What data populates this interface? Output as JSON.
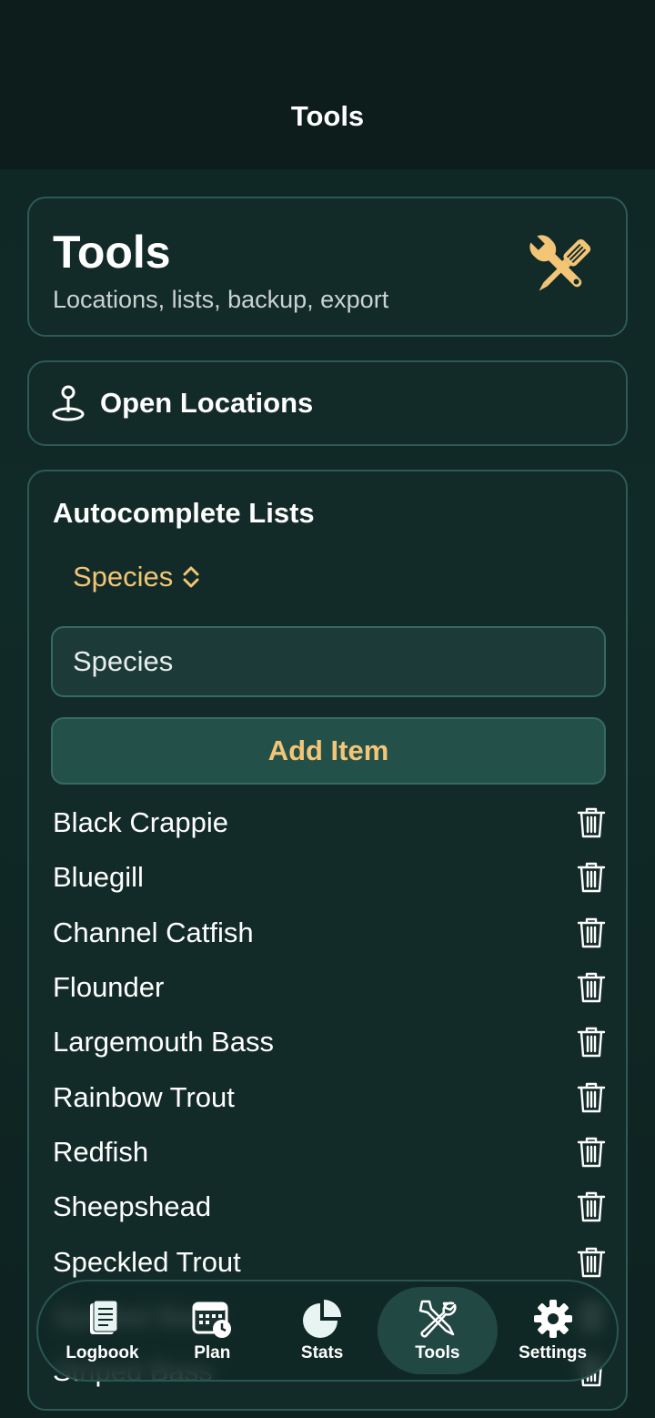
{
  "nav": {
    "title": "Tools"
  },
  "hero": {
    "title": "Tools",
    "subtitle": "Locations, lists, backup, export",
    "icon": "tools-icon"
  },
  "locations": {
    "label": "Open Locations",
    "icon": "map-pin-icon"
  },
  "lists": {
    "title": "Autocomplete Lists",
    "selected_list": "Species",
    "input_placeholder": "Species",
    "add_button": "Add Item",
    "items": [
      "Black Crappie",
      "Bluegill",
      "Channel Catfish",
      "Flounder",
      "Largemouth Bass",
      "Rainbow Trout",
      "Redfish",
      "Sheepshead",
      "Speckled Trout",
      "Spotted Bass",
      "Striped Bass"
    ]
  },
  "tabs": [
    {
      "label": "Logbook",
      "icon": "book-icon",
      "active": false
    },
    {
      "label": "Plan",
      "icon": "calendar-clock-icon",
      "active": false
    },
    {
      "label": "Stats",
      "icon": "pie-chart-icon",
      "active": false
    },
    {
      "label": "Tools",
      "icon": "tools-icon",
      "active": true
    },
    {
      "label": "Settings",
      "icon": "gear-icon",
      "active": false
    }
  ],
  "colors": {
    "accent": "#f2c577",
    "background": "#102a27",
    "card": "#132b28",
    "border": "#2d5a54"
  }
}
